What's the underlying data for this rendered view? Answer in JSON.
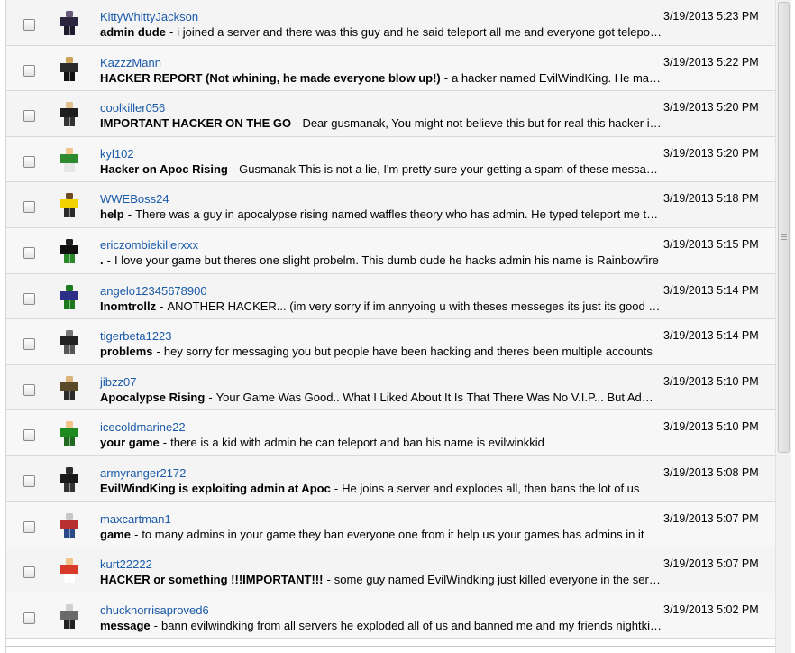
{
  "messages": [
    {
      "sender": "KittyWhittyJackson",
      "subject": "admin dude",
      "separator": "-",
      "preview": "i joined a server and there was this guy and he said teleport all me and everyone got teleported",
      "date": "3/19/2013 5:23 PM",
      "avatar": "robot-avatar-icon"
    },
    {
      "sender": "KazzzMann",
      "subject": "HACKER REPORT (Not whining, he made everyone blow up!)",
      "separator": "-",
      "preview": "a hacker named EvilWindKing. He made everyone blow up",
      "date": "3/19/2013 5:22 PM",
      "avatar": "avatar-icon"
    },
    {
      "sender": "coolkiller056",
      "subject": "IMPORTANT HACKER ON THE GO",
      "separator": "-",
      "preview": "Dear gusmanak, You might not believe this but for real this hacker is on the go",
      "date": "3/19/2013 5:20 PM",
      "avatar": "avatar-icon"
    },
    {
      "sender": "kyl102",
      "subject": "Hacker on Apoc Rising",
      "separator": "-",
      "preview": "Gusmanak This is not a lie, I'm pretty sure your getting a spam of these messages",
      "date": "3/19/2013 5:20 PM",
      "avatar": "avatar-icon"
    },
    {
      "sender": "WWEBoss24",
      "subject": "help",
      "separator": "-",
      "preview": "There was a guy in apocalypse rising named waffles theory who has admin. He typed teleport me to all",
      "date": "3/19/2013 5:18 PM",
      "avatar": "avatar-icon"
    },
    {
      "sender": "ericzombiekillerxxx",
      "subject": ".",
      "separator": "-",
      "preview": "I love your game but theres one slight probelm. This dumb dude he hacks admin his name is Rainbowfire",
      "date": "3/19/2013 5:15 PM",
      "avatar": "avatar-icon"
    },
    {
      "sender": "angelo12345678900",
      "subject": "Inomtrollz",
      "separator": "-",
      "preview": "ANOTHER HACKER... (im very sorry if im annyoing u with theses messeges its just its good to know)",
      "date": "3/19/2013 5:14 PM",
      "avatar": "avatar-icon"
    },
    {
      "sender": "tigerbeta1223",
      "subject": "problems",
      "separator": "-",
      "preview": "hey sorry for messaging you but people have been hacking and theres been multiple accounts",
      "date": "3/19/2013 5:14 PM",
      "avatar": "avatar-icon"
    },
    {
      "sender": "jibzz07",
      "subject": "Apocalypse Rising",
      "separator": "-",
      "preview": "Your Game Was Good.. What I Liked About It Is That There Was No V.I.P... But Admins",
      "date": "3/19/2013 5:10 PM",
      "avatar": "avatar-icon"
    },
    {
      "sender": "icecoldmarine22",
      "subject": "your game",
      "separator": "-",
      "preview": "there is a kid with admin he can teleport and ban his name is evilwinkkid",
      "date": "3/19/2013 5:10 PM",
      "avatar": "avatar-icon"
    },
    {
      "sender": "armyranger2172",
      "subject": "EvilWindKing is exploiting admin at Apoc",
      "separator": "-",
      "preview": "He joins a server and explodes all, then bans the lot of us",
      "date": "3/19/2013 5:08 PM",
      "avatar": "avatar-icon"
    },
    {
      "sender": "maxcartman1",
      "subject": "game",
      "separator": "-",
      "preview": "to many admins in your game they ban everyone one from it help us your games has admins in it",
      "date": "3/19/2013 5:07 PM",
      "avatar": "avatar-icon"
    },
    {
      "sender": "kurt22222",
      "subject": "HACKER or something !!!IMPORTANT!!!",
      "separator": "-",
      "preview": "some guy named EvilWindking just killed everyone in the server",
      "date": "3/19/2013 5:07 PM",
      "avatar": "avatar-icon"
    },
    {
      "sender": "chucknorrisaproved6",
      "subject": "message",
      "separator": "-",
      "preview": "bann evilwindking from all servers he exploded all of us and banned me and my friends nightkiller",
      "date": "3/19/2013 5:02 PM",
      "avatar": "avatar-icon"
    }
  ],
  "avatar_colors": [
    {
      "head": "#6a5a7a",
      "torso": "#2b2540",
      "legs": "#1c1c2a"
    },
    {
      "head": "#caa25a",
      "torso": "#2b2b2b",
      "legs": "#111111"
    },
    {
      "head": "#e0c090",
      "torso": "#1e1e1e",
      "legs": "#333333"
    },
    {
      "head": "#f2c48a",
      "torso": "#2f8a2f",
      "legs": "#e6e6e6"
    },
    {
      "head": "#6b4a24",
      "torso": "#f2d200",
      "legs": "#2a2a2a"
    },
    {
      "head": "#1e1e1e",
      "torso": "#101010",
      "legs": "#2a8a2a"
    },
    {
      "head": "#1c7a1c",
      "torso": "#2d2d8a",
      "legs": "#1c7a1c"
    },
    {
      "head": "#777777",
      "torso": "#222222",
      "legs": "#555555"
    },
    {
      "head": "#d7b37a",
      "torso": "#5a4a2a",
      "legs": "#2a2a2a"
    },
    {
      "head": "#f2c48a",
      "torso": "#1f8a1f",
      "legs": "#1f6a1f"
    },
    {
      "head": "#2b2b2b",
      "torso": "#1a1a1a",
      "legs": "#333333"
    },
    {
      "head": "#c8c8c8",
      "torso": "#b83030",
      "legs": "#2a4a8a"
    },
    {
      "head": "#f2c48a",
      "torso": "#d83a2a",
      "legs": "#ffffff"
    },
    {
      "head": "#d0d0d0",
      "torso": "#6a6a6a",
      "legs": "#222222"
    }
  ],
  "theme": {
    "link": "#1a5aa8",
    "row_border": "#d9d9d9"
  }
}
